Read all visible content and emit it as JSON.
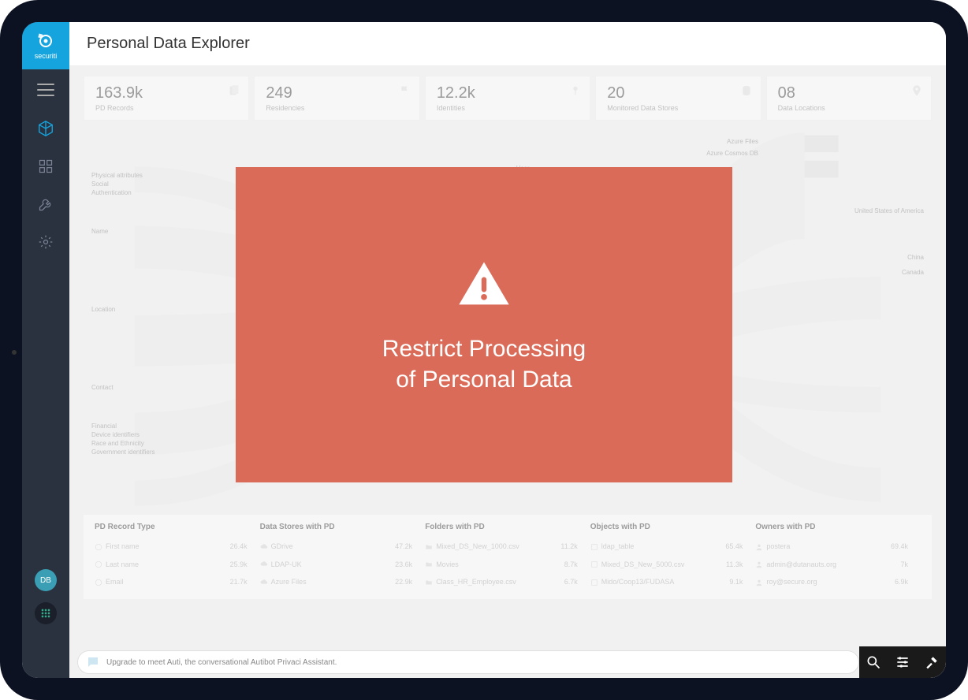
{
  "brand": "securiti",
  "page_title": "Personal Data Explorer",
  "avatar_initials": "DB",
  "stats": [
    {
      "value": "163.9k",
      "label": "PD Records"
    },
    {
      "value": "249",
      "label": "Residencies"
    },
    {
      "value": "12.2k",
      "label": "Identities"
    },
    {
      "value": "20",
      "label": "Monitored Data Stores"
    },
    {
      "value": "08",
      "label": "Data Locations"
    }
  ],
  "sankey_left": [
    "Physical attributes",
    "Social",
    "Authentication",
    "Name",
    "Location",
    "Contact",
    "Financial",
    "Device identifiers",
    "Race and Ethnicity",
    "Government identifiers"
  ],
  "sankey_mid": "User",
  "sankey_right_top": [
    "Azure Files",
    "Azure Cosmos DB"
  ],
  "sankey_right_bottom": [
    "United States of America",
    "China",
    "Canada"
  ],
  "table": {
    "headers": [
      "PD Record Type",
      "",
      "Data Stores with PD",
      "",
      "Folders with PD",
      "",
      "Objects with PD",
      "",
      "Owners with PD",
      ""
    ],
    "rows": [
      [
        "First name",
        "26.4k",
        "GDrive",
        "47.2k",
        "Mixed_DS_New_1000.csv",
        "11.2k",
        "ldap_table",
        "65.4k",
        "postera",
        "69.4k"
      ],
      [
        "Last name",
        "25.9k",
        "LDAP-UK",
        "23.6k",
        "Movies",
        "8.7k",
        "Mixed_DS_New_5000.csv",
        "11.3k",
        "admin@dutanauts.org",
        "7k"
      ],
      [
        "Email",
        "21.7k",
        "Azure Files",
        "22.9k",
        "Class_HR_Employee.csv",
        "6.7k",
        "Mido/Coop13/FUDASA",
        "9.1k",
        "roy@secure.org",
        "6.9k"
      ]
    ]
  },
  "chat_hint": "Upgrade to meet Auti, the conversational Autibot Privaci Assistant.",
  "modal": {
    "line1": "Restrict Processing",
    "line2": "of Personal Data"
  }
}
